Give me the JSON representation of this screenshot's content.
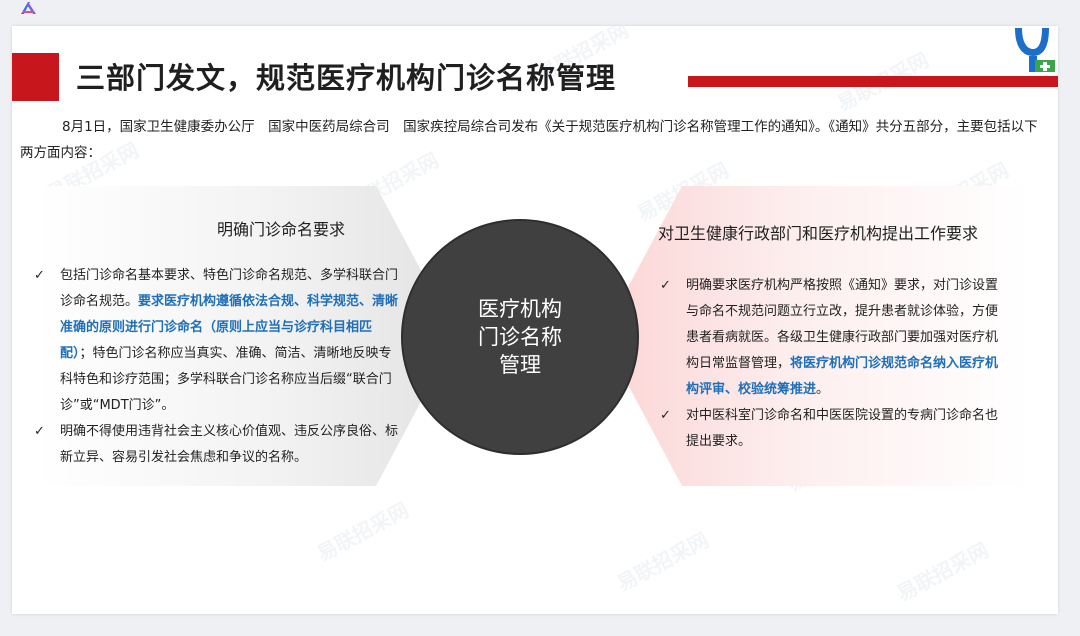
{
  "slide": {
    "title": "三部门发文，规范医疗机构门诊名称管理",
    "intro": "8月1日，国家卫生健康委办公厅　国家中医药局综合司　国家疾控局综合司发布《关于规范医疗机构门诊名称管理工作的通知》。《通知》共分五部分，主要包括以下两方面内容："
  },
  "left_panel": {
    "title": "明确门诊命名要求",
    "bullet1": {
      "a": "包括门诊命名基本要求、特色门诊命名规范、多学科联合门诊命名规范。",
      "highlight": "要求医疗机构遵循依法合规、科学规范、清晰准确的原则进行门诊命名（原则上应当与诊疗科目相匹配）",
      "b": "；特色门诊名称应当真实、准确、简洁、清晰地反映专科特色和诊疗范围；多学科联合门诊名称应当后缀“联合门诊”或“MDT门诊”。"
    },
    "bullet2": "明确不得使用违背社会主义核心价值观、违反公序良俗、标新立异、容易引发社会焦虑和争议的名称。"
  },
  "center": {
    "line1": "医疗机构",
    "line2": "门诊名称",
    "line3": "管理"
  },
  "right_panel": {
    "title": "对卫生健康行政部门和医疗机构提出工作要求",
    "bullet1": {
      "a": "明确要求医疗机构严格按照《通知》要求，对门诊设置与命名不规范问题立行立改，提升患者就诊体验，方便患者看病就医。各级卫生健康行政部门要加强对医疗机构日常监督管理，",
      "highlight": "将医疗机构门诊规范命名纳入医疗机构评审、校验统筹推进",
      "b": "。"
    },
    "bullet2": "对中医科室门诊命名和中医医院设置的专病门诊命名也提出要求。"
  },
  "check_glyph": "✓",
  "watermark_text": "易联招采网",
  "colors": {
    "accent_red": "#c8161d",
    "highlight_blue": "#1f6fb8",
    "circle": "#404040"
  }
}
